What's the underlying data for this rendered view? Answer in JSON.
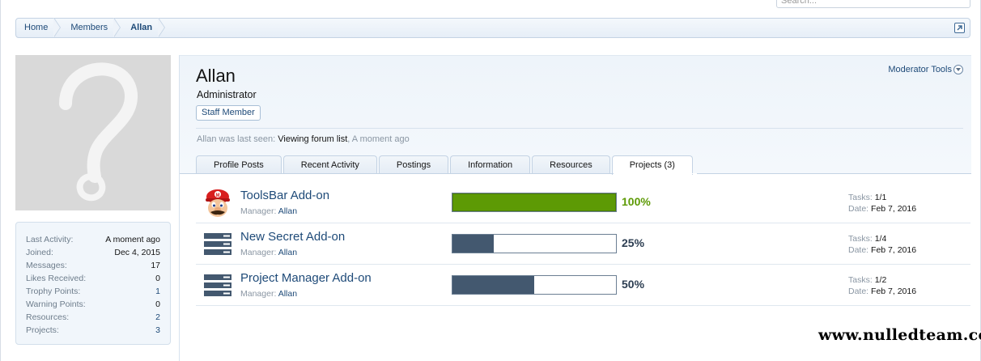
{
  "search": {
    "placeholder": "Search..."
  },
  "breadcrumb": {
    "items": [
      {
        "label": "Home"
      },
      {
        "label": "Members"
      },
      {
        "label": "Allan"
      }
    ]
  },
  "profile": {
    "name": "Allan",
    "title": "Administrator",
    "badge": "Staff Member",
    "moderator_tools": "Moderator Tools",
    "last_seen_prefix": "Allan was last seen:",
    "last_seen_activity": "Viewing forum list",
    "last_seen_sep": ",",
    "last_seen_time": "A moment ago"
  },
  "stats": [
    {
      "label": "Last Activity:",
      "value": "A moment ago"
    },
    {
      "label": "Joined:",
      "value": "Dec 4, 2015"
    },
    {
      "label": "Messages:",
      "value": "17"
    },
    {
      "label": "Likes Received:",
      "value": "0"
    },
    {
      "label": "Trophy Points:",
      "value": "1"
    },
    {
      "label": "Warning Points:",
      "value": "0"
    },
    {
      "label": "Resources:",
      "value": "2"
    },
    {
      "label": "Projects:",
      "value": "3"
    }
  ],
  "tabs": [
    {
      "label": "Profile Posts"
    },
    {
      "label": "Recent Activity"
    },
    {
      "label": "Postings"
    },
    {
      "label": "Information"
    },
    {
      "label": "Resources"
    },
    {
      "label": "Projects (3)"
    }
  ],
  "projects": [
    {
      "title": "ToolsBar Add-on",
      "manager_label": "Manager:",
      "manager": "Allan",
      "progress": 100,
      "progress_label": "100%",
      "tasks_label": "Tasks:",
      "tasks": "1/1",
      "date_label": "Date:",
      "date": "Feb 7, 2016",
      "icon": "mario-avatar-icon"
    },
    {
      "title": "New Secret Add-on",
      "manager_label": "Manager:",
      "manager": "Allan",
      "progress": 25,
      "progress_label": "25%",
      "tasks_label": "Tasks:",
      "tasks": "1/4",
      "date_label": "Date:",
      "date": "Feb 7, 2016",
      "icon": "server-stack-icon"
    },
    {
      "title": "Project Manager Add-on",
      "manager_label": "Manager:",
      "manager": "Allan",
      "progress": 50,
      "progress_label": "50%",
      "tasks_label": "Tasks:",
      "tasks": "1/2",
      "date_label": "Date:",
      "date": "Feb 7, 2016",
      "icon": "server-stack-icon"
    }
  ],
  "colors": {
    "accent": "#1e4a78",
    "progress_done": "#5d9a05",
    "progress_partial": "#43586f"
  },
  "watermark": "www.nulledteam.com"
}
